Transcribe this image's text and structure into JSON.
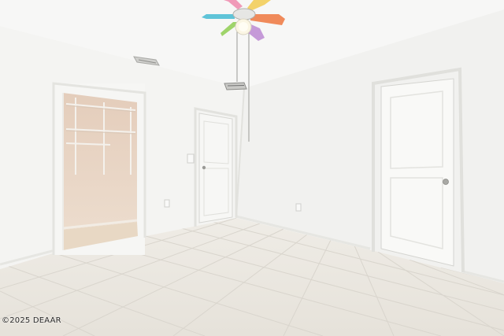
{
  "photo": {
    "watermark": "©2025 DEAAR",
    "scene_objects": {
      "ceiling_fan": {
        "blade_colors": [
          "#f3b24e",
          "#f08a5a",
          "#c59ad8",
          "#9fd46a",
          "#5fc4d8",
          "#f09ab8"
        ]
      },
      "walk_in_closet": {
        "wall_color": "#e9d6c6",
        "floor_color": "#e8d8c4"
      },
      "left_door": {
        "color": "#f7f7f5"
      },
      "right_door": {
        "color": "#f9f9f7"
      },
      "tile_floor": {
        "color": "#ebe8e2"
      }
    }
  }
}
